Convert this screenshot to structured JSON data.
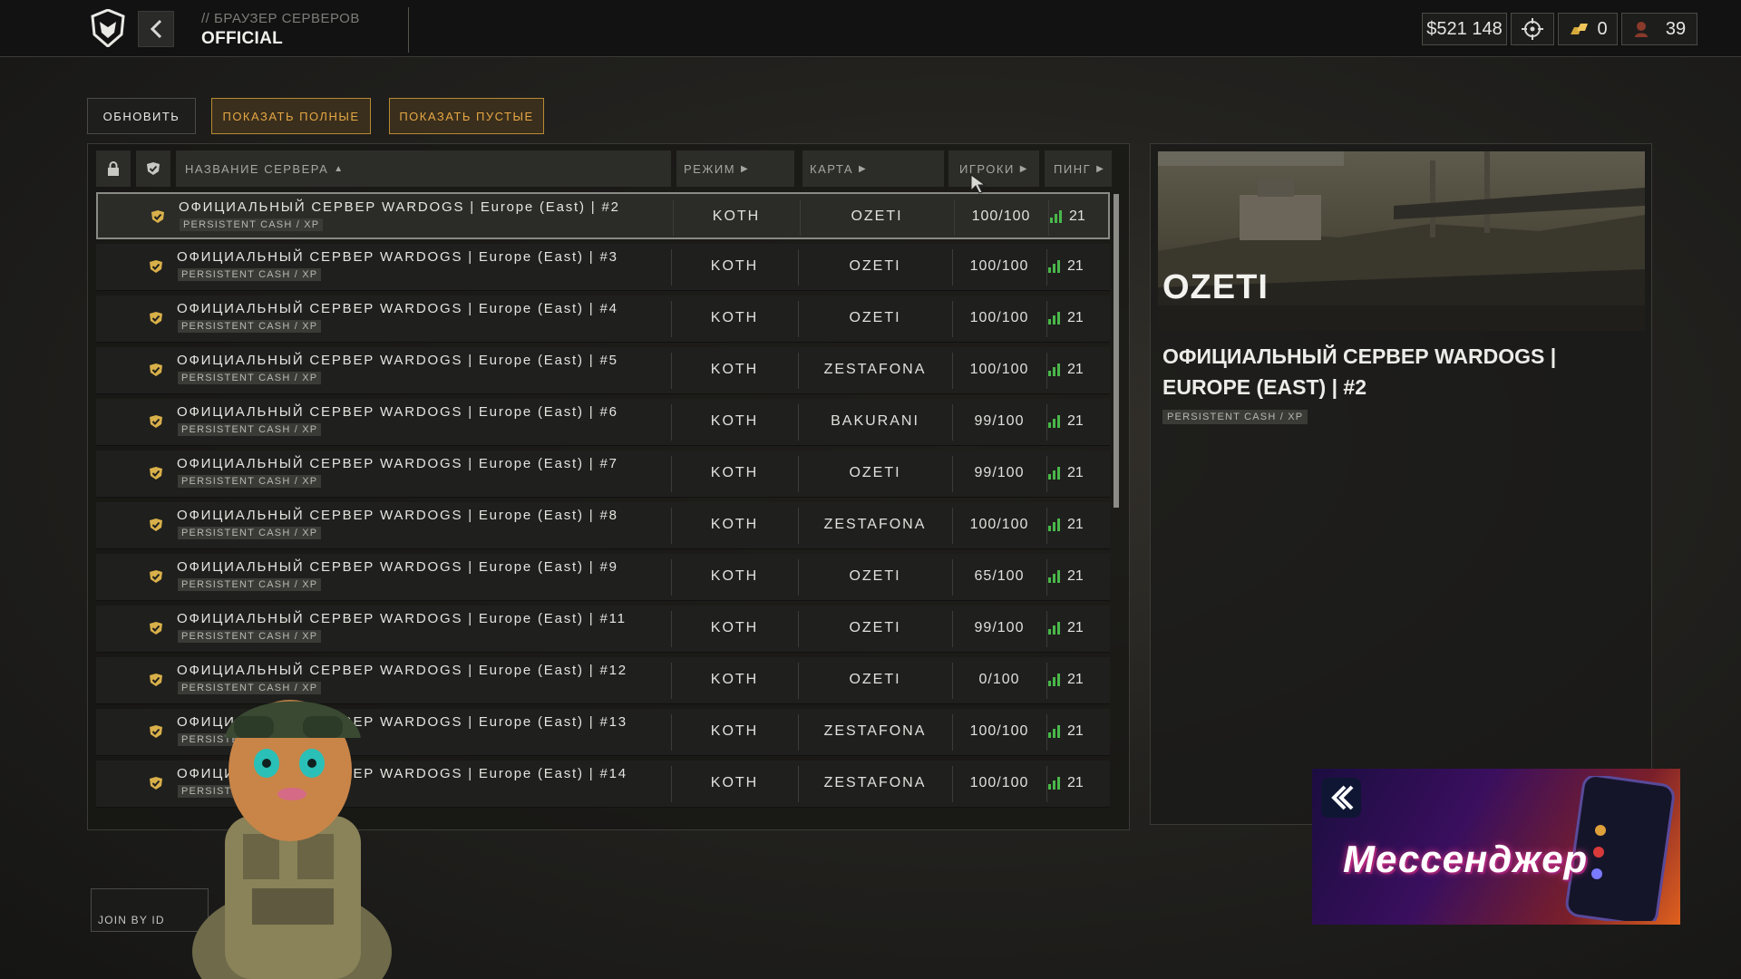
{
  "header": {
    "breadcrumb": "// БРАУЗЕР СЕРВЕРОВ",
    "title": "OFFICIAL",
    "money": "$521 148",
    "currency": "0",
    "level": "39"
  },
  "toolbar": {
    "refresh": "ОБНОВИТЬ",
    "show_full": "ПОКАЗАТЬ ПОЛНЫЕ",
    "show_empty": "ПОКАЗАТЬ ПУСТЫЕ"
  },
  "columns": {
    "name": "НАЗВАНИЕ СЕРВЕРА",
    "mode": "РЕЖИМ",
    "map": "КАРТА",
    "players": "ИГРОКИ",
    "ping": "ПИНГ"
  },
  "servers": [
    {
      "name": "ОФИЦИАЛЬНЫЙ СЕРВЕР WARDOGS | Europe (East) | #2",
      "tag": "PERSISTENT CASH / XP",
      "mode": "KOTH",
      "map": "OZETI",
      "players": "100/100",
      "ping": "21"
    },
    {
      "name": "ОФИЦИАЛЬНЫЙ СЕРВЕР WARDOGS | Europe (East) | #3",
      "tag": "PERSISTENT CASH / XP",
      "mode": "KOTH",
      "map": "OZETI",
      "players": "100/100",
      "ping": "21"
    },
    {
      "name": "ОФИЦИАЛЬНЫЙ СЕРВЕР WARDOGS | Europe (East) | #4",
      "tag": "PERSISTENT CASH / XP",
      "mode": "KOTH",
      "map": "OZETI",
      "players": "100/100",
      "ping": "21"
    },
    {
      "name": "ОФИЦИАЛЬНЫЙ СЕРВЕР WARDOGS | Europe (East) | #5",
      "tag": "PERSISTENT CASH / XP",
      "mode": "KOTH",
      "map": "ZESTAFONA",
      "players": "100/100",
      "ping": "21"
    },
    {
      "name": "ОФИЦИАЛЬНЫЙ СЕРВЕР WARDOGS | Europe (East) | #6",
      "tag": "PERSISTENT CASH / XP",
      "mode": "KOTH",
      "map": "BAKURANI",
      "players": "99/100",
      "ping": "21"
    },
    {
      "name": "ОФИЦИАЛЬНЫЙ СЕРВЕР WARDOGS | Europe (East) | #7",
      "tag": "PERSISTENT CASH / XP",
      "mode": "KOTH",
      "map": "OZETI",
      "players": "99/100",
      "ping": "21"
    },
    {
      "name": "ОФИЦИАЛЬНЫЙ СЕРВЕР WARDOGS | Europe (East) | #8",
      "tag": "PERSISTENT CASH / XP",
      "mode": "KOTH",
      "map": "ZESTAFONA",
      "players": "100/100",
      "ping": "21"
    },
    {
      "name": "ОФИЦИАЛЬНЫЙ СЕРВЕР WARDOGS | Europe (East) | #9",
      "tag": "PERSISTENT CASH / XP",
      "mode": "KOTH",
      "map": "OZETI",
      "players": "65/100",
      "ping": "21"
    },
    {
      "name": "ОФИЦИАЛЬНЫЙ СЕРВЕР WARDOGS | Europe (East) | #11",
      "tag": "PERSISTENT CASH / XP",
      "mode": "KOTH",
      "map": "OZETI",
      "players": "99/100",
      "ping": "21"
    },
    {
      "name": "ОФИЦИАЛЬНЫЙ СЕРВЕР WARDOGS | Europe (East) | #12",
      "tag": "PERSISTENT CASH / XP",
      "mode": "KOTH",
      "map": "OZETI",
      "players": "0/100",
      "ping": "21"
    },
    {
      "name": "ОФИЦИАЛЬНЫЙ СЕРВЕР WARDOGS | Europe (East) | #13",
      "tag": "PERSISTENT CASH / XP",
      "mode": "KOTH",
      "map": "ZESTAFONA",
      "players": "100/100",
      "ping": "21"
    },
    {
      "name": "ОФИЦИАЛЬНЫЙ СЕРВЕР WARDOGS | Europe (East) | #14",
      "tag": "PERSISTENT CASH / XP",
      "mode": "KOTH",
      "map": "ZESTAFONA",
      "players": "100/100",
      "ping": "21"
    }
  ],
  "details": {
    "map_name": "OZETI",
    "server_name": "ОФИЦИАЛЬНЫЙ СЕРВЕР WARDOGS | EUROPE (EAST) | #2",
    "tag": "PERSISTENT CASH / XP"
  },
  "footer": {
    "join_by_id": "JOIN BY ID"
  },
  "ad": {
    "text": "Мессенджер"
  },
  "colors": {
    "accent_orange": "#e5a745",
    "ping_green": "#49b84a",
    "check_gold": "#d8b04a"
  }
}
